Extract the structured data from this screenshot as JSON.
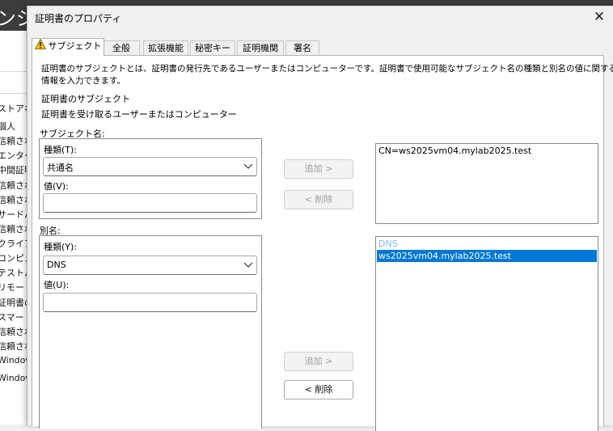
{
  "background_window": {
    "title": "ンジャ",
    "store_column_header": "ストア名",
    "items": [
      "個人",
      "信頼され",
      "エンタープ",
      "中間証明",
      "信頼され",
      "信頼され",
      "サードパー",
      "信頼され",
      "クライアン",
      "コンピュー",
      "テストルー",
      "リモートデ",
      "証明書の",
      "スマートカ",
      "信頼され",
      "信頼され",
      "Window",
      "Window"
    ]
  },
  "dialog": {
    "title": "証明書のプロパティ",
    "close": "✕",
    "tabs": [
      {
        "label": "サブジェクト",
        "active": true,
        "icon": "warning-icon"
      },
      {
        "label": "全般"
      },
      {
        "label": "拡張機能"
      },
      {
        "label": "秘密キー"
      },
      {
        "label": "証明機関"
      },
      {
        "label": "署名"
      }
    ],
    "description": "証明書のサブジェクトとは、証明書の発行先であるユーザーまたはコンピューターです。証明書で使用可能なサブジェクト名の種類と別名の値に関する",
    "description_line2": "情報を入力できます。",
    "section_heading": "証明書のサブジェクト",
    "section_sub": "証明書を受け取るユーザーまたはコンピューター",
    "subject_name": {
      "label": "サブジェクト名:",
      "type_label": "種類(T):",
      "type_value": "共通名",
      "value_label": "値(V):",
      "value": "",
      "add_button": "追加 >",
      "remove_button": "< 削除",
      "list": [
        "CN=ws2025vm04.mylab2025.test"
      ]
    },
    "alt_name": {
      "label": "別名:",
      "type_label": "種類(Y):",
      "type_value": "DNS",
      "value_label": "値(U):",
      "value": "",
      "add_button": "追加 >",
      "remove_button": "< 削除",
      "list_header": "DNS",
      "list": [
        "ws2025vm04.mylab2025.test"
      ]
    }
  },
  "colors": {
    "selection": "#0078d7",
    "list_header": "#87bde8",
    "warning": "#f2c200",
    "background_titlebar": "#3c3c3c"
  }
}
